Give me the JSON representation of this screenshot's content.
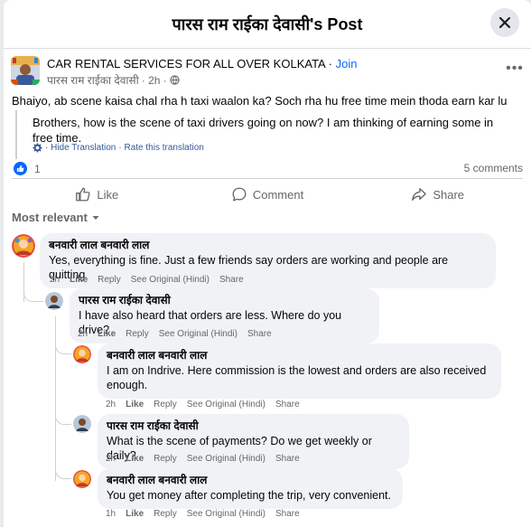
{
  "header": {
    "title": "पारस राम राईका देवासी's Post"
  },
  "post": {
    "group_name": "CAR RENTAL SERVICES FOR ALL OVER KOLKATA",
    "separator": "·",
    "join_label": "Join",
    "author": "पारस राम राईका देवासी",
    "time": "· 2h ·",
    "text": "Bhaiyo, ab scene kaisa chal rha h taxi waalon ka? Soch rha hu free time mein thoda earn kar lu",
    "translation": "Brothers, how is the scene of taxi drivers going on now? I am thinking of earning some in free time.",
    "hide_translation": "· Hide Translation",
    "rate_translation": "· Rate this translation"
  },
  "stats": {
    "reactions": "1",
    "comments": "5 comments"
  },
  "actions": {
    "like": "Like",
    "comment": "Comment",
    "share": "Share"
  },
  "sort": {
    "label": "Most relevant"
  },
  "comments": [
    {
      "name": "बनवारी लाल बनवारी लाल",
      "text": "Yes, everything is fine. Just a few friends say orders are working and people are quitting",
      "time": "2h",
      "like": "Like",
      "reply": "Reply",
      "see_original": "See Original (Hindi)",
      "share": "Share"
    },
    {
      "name": "पारस राम राईका देवासी",
      "text": "I have also heard that orders are less. Where do you drive?",
      "time": "2h",
      "like": "Like",
      "reply": "Reply",
      "see_original": "See Original (Hindi)",
      "share": "Share"
    },
    {
      "name": "बनवारी लाल बनवारी लाल",
      "text": "I am on Indrive. Here commission is the lowest and orders are also received enough.",
      "time": "2h",
      "like": "Like",
      "reply": "Reply",
      "see_original": "See Original (Hindi)",
      "share": "Share"
    },
    {
      "name": "पारस राम राईका देवासी",
      "text": "What is the scene of payments? Do we get weekly or daily?",
      "time": "2h",
      "like": "Like",
      "reply": "Reply",
      "see_original": "See Original (Hindi)",
      "share": "Share"
    },
    {
      "name": "बनवारी लाल बनवारी लाल",
      "text": "You get money after completing the trip, very convenient.",
      "time": "1h",
      "like": "Like",
      "reply": "Reply",
      "see_original": "See Original (Hindi)",
      "share": "Share"
    }
  ],
  "colors": {
    "accent": "#0866ff",
    "muted": "#65676b",
    "bubble": "#f0f2f5"
  }
}
